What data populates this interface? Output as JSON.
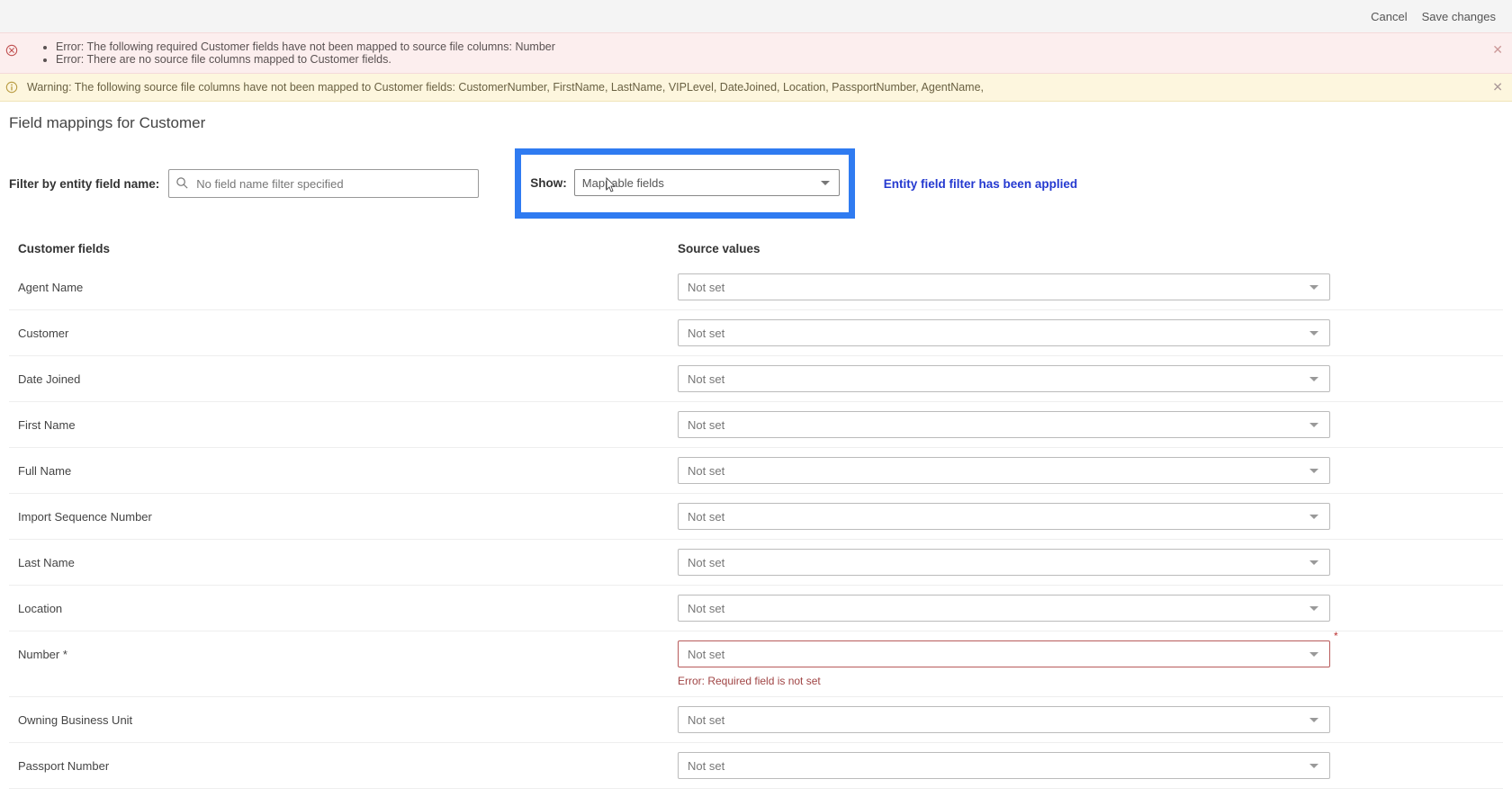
{
  "topbar": {
    "cancel": "Cancel",
    "save": "Save changes"
  },
  "error_banner": {
    "bullets": [
      "Error: The following required Customer fields have not been mapped to source file columns: Number",
      "Error: There are no source file columns mapped to Customer fields."
    ]
  },
  "warn_banner": {
    "text": "Warning: The following source file columns have not been mapped to Customer fields: CustomerNumber, FirstName, LastName, VIPLevel, DateJoined, Location, PassportNumber, AgentName,"
  },
  "page_title": "Field mappings for Customer",
  "filter": {
    "label": "Filter by entity field name:",
    "placeholder": "No field name filter specified",
    "show_label": "Show:",
    "show_value": "Mappable fields",
    "applied_text": "Entity field filter has been applied"
  },
  "columns": {
    "left": "Customer fields",
    "right": "Source values"
  },
  "not_set": "Not set",
  "required_error": "Error: Required field is not set",
  "fields": [
    {
      "label": "Agent Name"
    },
    {
      "label": "Customer"
    },
    {
      "label": "Date Joined"
    },
    {
      "label": "First Name"
    },
    {
      "label": "Full Name"
    },
    {
      "label": "Import Sequence Number"
    },
    {
      "label": "Last Name"
    },
    {
      "label": "Location"
    },
    {
      "label": "Number *",
      "required": true,
      "error": true
    },
    {
      "label": "Owning Business Unit"
    },
    {
      "label": "Passport Number"
    }
  ]
}
